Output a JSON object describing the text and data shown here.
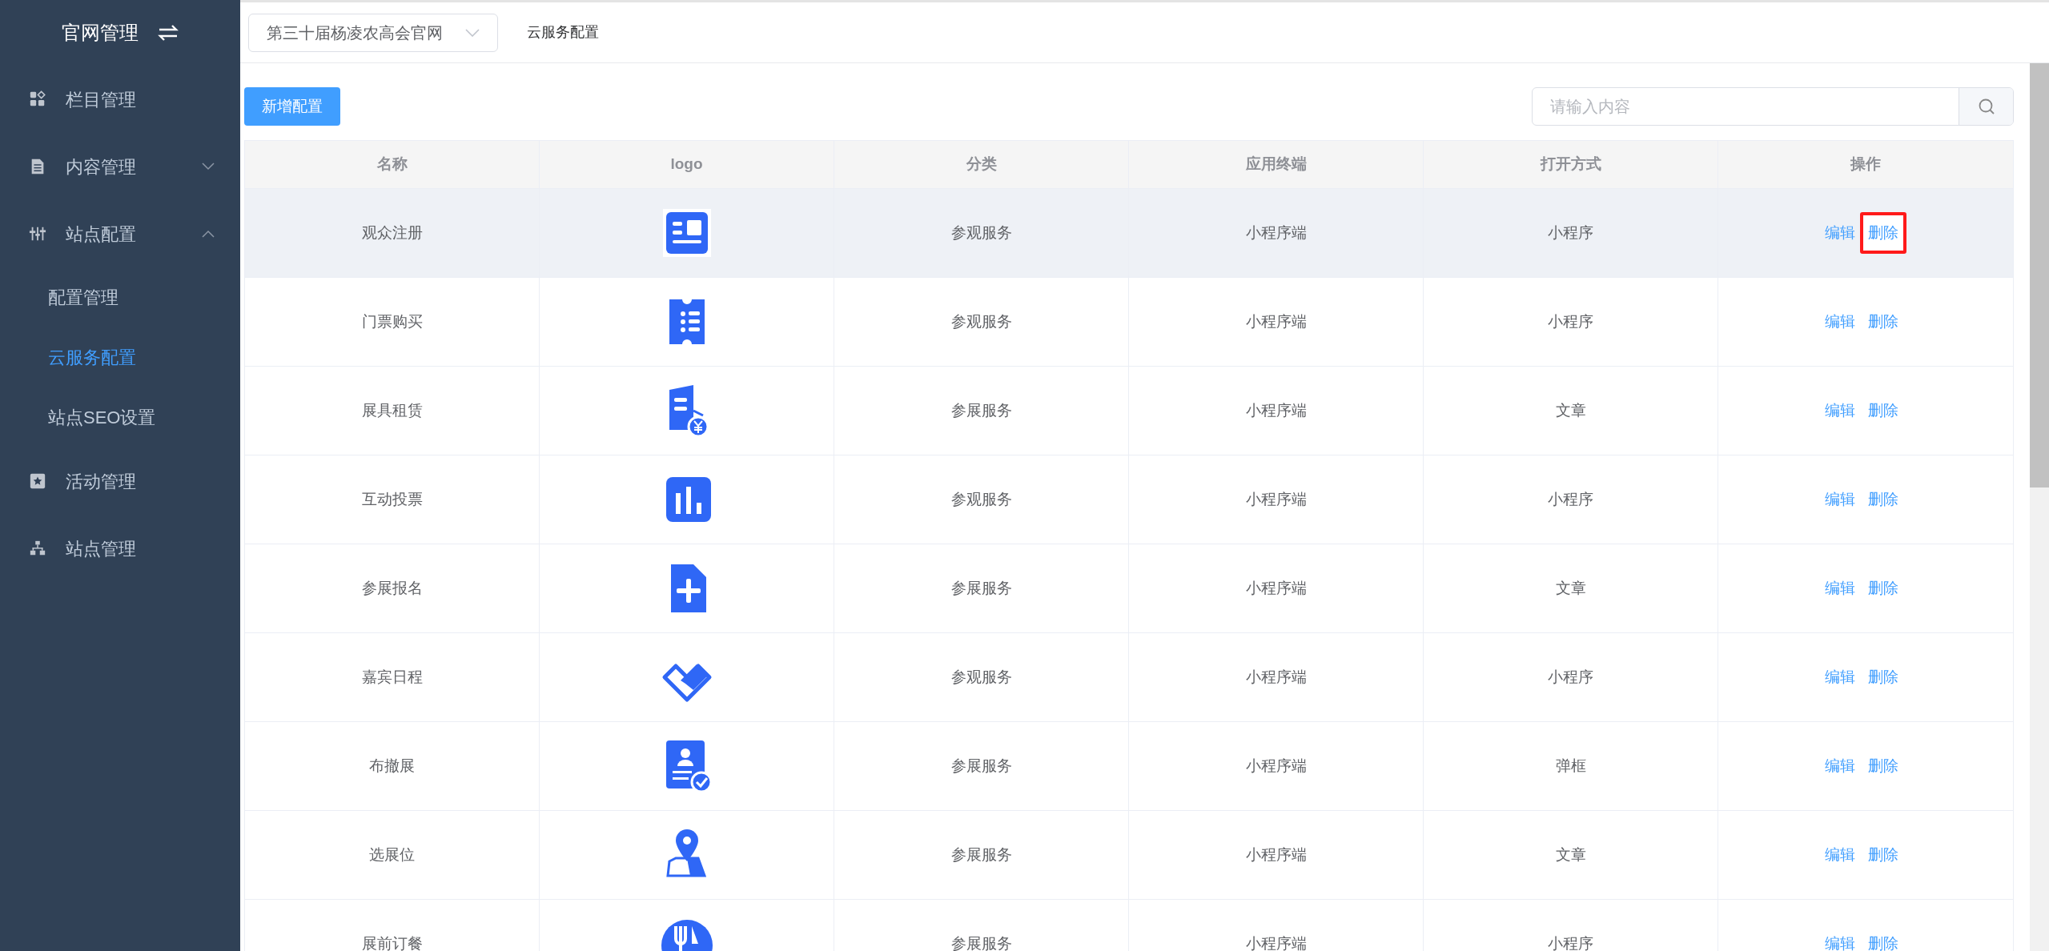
{
  "sidebar": {
    "title": "官网管理",
    "items": [
      {
        "label": "栏目管理"
      },
      {
        "label": "内容管理",
        "expanded": false
      },
      {
        "label": "站点配置",
        "expanded": true,
        "children": [
          {
            "label": "配置管理",
            "selected": false
          },
          {
            "label": "云服务配置",
            "selected": true
          },
          {
            "label": "站点SEO设置",
            "selected": false
          }
        ]
      },
      {
        "label": "活动管理"
      },
      {
        "label": "站点管理"
      }
    ]
  },
  "topbar": {
    "site_select": {
      "value": "第三十届杨凌农高会官网"
    },
    "breadcrumb": "云服务配置"
  },
  "toolbar": {
    "add_button": "新增配置",
    "search": {
      "placeholder": "请输入内容"
    }
  },
  "table": {
    "columns": [
      "名称",
      "logo",
      "分类",
      "应用终端",
      "打开方式",
      "操作"
    ],
    "rows": [
      {
        "name": "观众注册",
        "category": "参观服务",
        "terminal": "小程序端",
        "open_mode": "小程序",
        "actions": [
          "编辑",
          "删除"
        ],
        "hovered": true,
        "delete_marked": true
      },
      {
        "name": "门票购买",
        "category": "参观服务",
        "terminal": "小程序端",
        "open_mode": "小程序",
        "actions": [
          "编辑",
          "删除"
        ],
        "hovered": false,
        "delete_marked": false
      },
      {
        "name": "展具租赁",
        "category": "参展服务",
        "terminal": "小程序端",
        "open_mode": "文章",
        "actions": [
          "编辑",
          "删除"
        ],
        "hovered": false,
        "delete_marked": false
      },
      {
        "name": "互动投票",
        "category": "参观服务",
        "terminal": "小程序端",
        "open_mode": "小程序",
        "actions": [
          "编辑",
          "删除"
        ],
        "hovered": false,
        "delete_marked": false
      },
      {
        "name": "参展报名",
        "category": "参展服务",
        "terminal": "小程序端",
        "open_mode": "文章",
        "actions": [
          "编辑",
          "删除"
        ],
        "hovered": false,
        "delete_marked": false
      },
      {
        "name": "嘉宾日程",
        "category": "参观服务",
        "terminal": "小程序端",
        "open_mode": "小程序",
        "actions": [
          "编辑",
          "删除"
        ],
        "hovered": false,
        "delete_marked": false
      },
      {
        "name": "布撤展",
        "category": "参展服务",
        "terminal": "小程序端",
        "open_mode": "弹框",
        "actions": [
          "编辑",
          "删除"
        ],
        "hovered": false,
        "delete_marked": false
      },
      {
        "name": "选展位",
        "category": "参展服务",
        "terminal": "小程序端",
        "open_mode": "文章",
        "actions": [
          "编辑",
          "删除"
        ],
        "hovered": false,
        "delete_marked": false
      },
      {
        "name": "展前订餐",
        "category": "参展服务",
        "terminal": "小程序端",
        "open_mode": "小程序",
        "actions": [
          "编辑",
          "删除"
        ],
        "hovered": false,
        "delete_marked": false
      }
    ]
  }
}
